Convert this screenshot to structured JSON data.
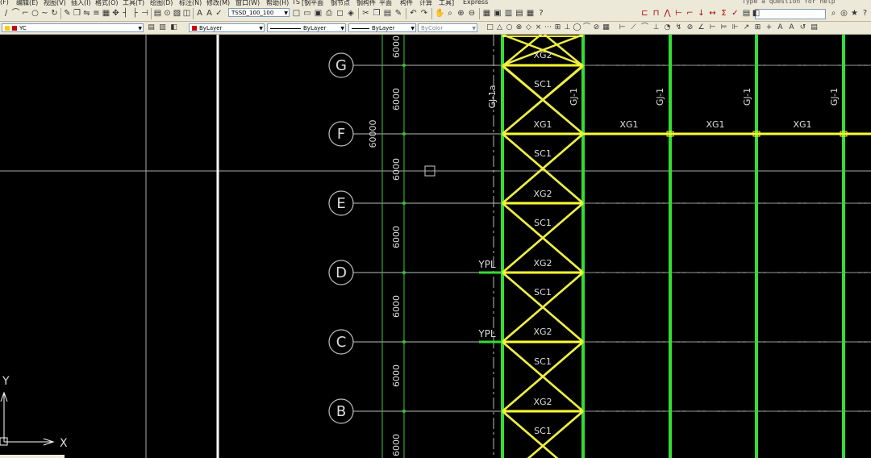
{
  "menubar": {
    "items": [
      "(F)",
      "编辑(E)",
      "视图(V)",
      "插入(I)",
      "格式(O)",
      "工具(T)",
      "绘图(D)",
      "标注(N)",
      "修改(M)",
      "窗口(W)",
      "帮助(H)",
      "TS",
      "[钢平面",
      "钢节点",
      "钢构件",
      "平面",
      "构件",
      "计算",
      "工具]",
      "Express"
    ],
    "help_placeholder": "Type a question for help"
  },
  "toolbar_styles": {
    "text_style_value": "TSSD_100_100"
  },
  "toolbar_layers": {
    "current_layer": "YC",
    "color_value": "ByLayer",
    "linetype_value": "ByLayer",
    "lineweight_value": "ByLayer",
    "plotstyle_value": "ByColor"
  },
  "colors": {
    "background": "#000000",
    "axis_line": "#bbbbbb",
    "column": "#33dd33",
    "beam": "#ffff33",
    "bracing": "#eeee44",
    "label": "#dddddd",
    "dim_line": "#33cc33",
    "beam_label_text": "#dddddd"
  },
  "drawing": {
    "grid_axes": [
      {
        "label": "G"
      },
      {
        "label": "F"
      },
      {
        "label": "E"
      },
      {
        "label": "D"
      },
      {
        "label": "C"
      },
      {
        "label": "B"
      }
    ],
    "bay_dimension": "6000",
    "total_dimension": "60000",
    "rafter_labels": [
      "GJ-1a",
      "GJ-1",
      "GJ-1",
      "GJ-1",
      "GJ-1"
    ],
    "bay_labels": [
      "XG2",
      "SC1",
      "XG1",
      "SC1",
      "XG2",
      "SC1",
      "XG2",
      "SC1",
      "XG2",
      "SC1",
      "XG2",
      "SC1"
    ],
    "ridge_beam_labels": [
      "XG1",
      "XG1",
      "XG1"
    ],
    "ypl_labels": [
      "YPL",
      "YPL"
    ],
    "ucs": {
      "x_label": "X",
      "y_label": "Y"
    }
  }
}
